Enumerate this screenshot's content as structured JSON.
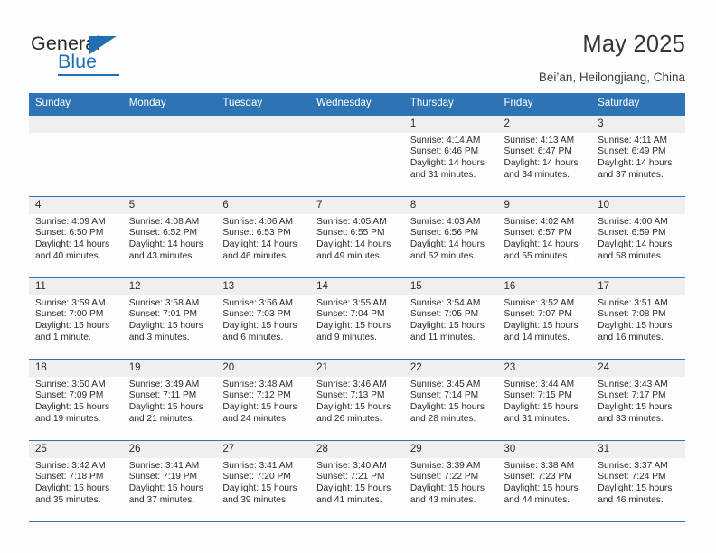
{
  "logo": {
    "word_one": "General",
    "word_two": "Blue",
    "triangle_icon": "blue-triangle-icon"
  },
  "header": {
    "title": "May 2025",
    "subtitle": "Bei’an, Heilongjiang, China"
  },
  "colors": {
    "header_blue": "#2e74b5",
    "daynum_gray": "#efefef",
    "page_bg": "#fdfdfd",
    "text": "#2b2b2b",
    "logo_blue": "#1f6fb5"
  },
  "weekday_headers": [
    "Sunday",
    "Monday",
    "Tuesday",
    "Wednesday",
    "Thursday",
    "Friday",
    "Saturday"
  ],
  "labels": {
    "sunrise": "Sunrise:",
    "sunset": "Sunset:",
    "daylight": "Daylight:"
  },
  "weeks": [
    [
      {
        "day": "",
        "empty": true
      },
      {
        "day": "",
        "empty": true
      },
      {
        "day": "",
        "empty": true
      },
      {
        "day": "",
        "empty": true
      },
      {
        "day": "1",
        "sunrise": "Sunrise: 4:14 AM",
        "sunset": "Sunset: 6:46 PM",
        "daylight_l1": "Daylight: 14 hours",
        "daylight_l2": "and 31 minutes."
      },
      {
        "day": "2",
        "sunrise": "Sunrise: 4:13 AM",
        "sunset": "Sunset: 6:47 PM",
        "daylight_l1": "Daylight: 14 hours",
        "daylight_l2": "and 34 minutes."
      },
      {
        "day": "3",
        "sunrise": "Sunrise: 4:11 AM",
        "sunset": "Sunset: 6:49 PM",
        "daylight_l1": "Daylight: 14 hours",
        "daylight_l2": "and 37 minutes."
      }
    ],
    [
      {
        "day": "4",
        "sunrise": "Sunrise: 4:09 AM",
        "sunset": "Sunset: 6:50 PM",
        "daylight_l1": "Daylight: 14 hours",
        "daylight_l2": "and 40 minutes."
      },
      {
        "day": "5",
        "sunrise": "Sunrise: 4:08 AM",
        "sunset": "Sunset: 6:52 PM",
        "daylight_l1": "Daylight: 14 hours",
        "daylight_l2": "and 43 minutes."
      },
      {
        "day": "6",
        "sunrise": "Sunrise: 4:06 AM",
        "sunset": "Sunset: 6:53 PM",
        "daylight_l1": "Daylight: 14 hours",
        "daylight_l2": "and 46 minutes."
      },
      {
        "day": "7",
        "sunrise": "Sunrise: 4:05 AM",
        "sunset": "Sunset: 6:55 PM",
        "daylight_l1": "Daylight: 14 hours",
        "daylight_l2": "and 49 minutes."
      },
      {
        "day": "8",
        "sunrise": "Sunrise: 4:03 AM",
        "sunset": "Sunset: 6:56 PM",
        "daylight_l1": "Daylight: 14 hours",
        "daylight_l2": "and 52 minutes."
      },
      {
        "day": "9",
        "sunrise": "Sunrise: 4:02 AM",
        "sunset": "Sunset: 6:57 PM",
        "daylight_l1": "Daylight: 14 hours",
        "daylight_l2": "and 55 minutes."
      },
      {
        "day": "10",
        "sunrise": "Sunrise: 4:00 AM",
        "sunset": "Sunset: 6:59 PM",
        "daylight_l1": "Daylight: 14 hours",
        "daylight_l2": "and 58 minutes."
      }
    ],
    [
      {
        "day": "11",
        "sunrise": "Sunrise: 3:59 AM",
        "sunset": "Sunset: 7:00 PM",
        "daylight_l1": "Daylight: 15 hours",
        "daylight_l2": "and 1 minute."
      },
      {
        "day": "12",
        "sunrise": "Sunrise: 3:58 AM",
        "sunset": "Sunset: 7:01 PM",
        "daylight_l1": "Daylight: 15 hours",
        "daylight_l2": "and 3 minutes."
      },
      {
        "day": "13",
        "sunrise": "Sunrise: 3:56 AM",
        "sunset": "Sunset: 7:03 PM",
        "daylight_l1": "Daylight: 15 hours",
        "daylight_l2": "and 6 minutes."
      },
      {
        "day": "14",
        "sunrise": "Sunrise: 3:55 AM",
        "sunset": "Sunset: 7:04 PM",
        "daylight_l1": "Daylight: 15 hours",
        "daylight_l2": "and 9 minutes."
      },
      {
        "day": "15",
        "sunrise": "Sunrise: 3:54 AM",
        "sunset": "Sunset: 7:05 PM",
        "daylight_l1": "Daylight: 15 hours",
        "daylight_l2": "and 11 minutes."
      },
      {
        "day": "16",
        "sunrise": "Sunrise: 3:52 AM",
        "sunset": "Sunset: 7:07 PM",
        "daylight_l1": "Daylight: 15 hours",
        "daylight_l2": "and 14 minutes."
      },
      {
        "day": "17",
        "sunrise": "Sunrise: 3:51 AM",
        "sunset": "Sunset: 7:08 PM",
        "daylight_l1": "Daylight: 15 hours",
        "daylight_l2": "and 16 minutes."
      }
    ],
    [
      {
        "day": "18",
        "sunrise": "Sunrise: 3:50 AM",
        "sunset": "Sunset: 7:09 PM",
        "daylight_l1": "Daylight: 15 hours",
        "daylight_l2": "and 19 minutes."
      },
      {
        "day": "19",
        "sunrise": "Sunrise: 3:49 AM",
        "sunset": "Sunset: 7:11 PM",
        "daylight_l1": "Daylight: 15 hours",
        "daylight_l2": "and 21 minutes."
      },
      {
        "day": "20",
        "sunrise": "Sunrise: 3:48 AM",
        "sunset": "Sunset: 7:12 PM",
        "daylight_l1": "Daylight: 15 hours",
        "daylight_l2": "and 24 minutes."
      },
      {
        "day": "21",
        "sunrise": "Sunrise: 3:46 AM",
        "sunset": "Sunset: 7:13 PM",
        "daylight_l1": "Daylight: 15 hours",
        "daylight_l2": "and 26 minutes."
      },
      {
        "day": "22",
        "sunrise": "Sunrise: 3:45 AM",
        "sunset": "Sunset: 7:14 PM",
        "daylight_l1": "Daylight: 15 hours",
        "daylight_l2": "and 28 minutes."
      },
      {
        "day": "23",
        "sunrise": "Sunrise: 3:44 AM",
        "sunset": "Sunset: 7:15 PM",
        "daylight_l1": "Daylight: 15 hours",
        "daylight_l2": "and 31 minutes."
      },
      {
        "day": "24",
        "sunrise": "Sunrise: 3:43 AM",
        "sunset": "Sunset: 7:17 PM",
        "daylight_l1": "Daylight: 15 hours",
        "daylight_l2": "and 33 minutes."
      }
    ],
    [
      {
        "day": "25",
        "sunrise": "Sunrise: 3:42 AM",
        "sunset": "Sunset: 7:18 PM",
        "daylight_l1": "Daylight: 15 hours",
        "daylight_l2": "and 35 minutes."
      },
      {
        "day": "26",
        "sunrise": "Sunrise: 3:41 AM",
        "sunset": "Sunset: 7:19 PM",
        "daylight_l1": "Daylight: 15 hours",
        "daylight_l2": "and 37 minutes."
      },
      {
        "day": "27",
        "sunrise": "Sunrise: 3:41 AM",
        "sunset": "Sunset: 7:20 PM",
        "daylight_l1": "Daylight: 15 hours",
        "daylight_l2": "and 39 minutes."
      },
      {
        "day": "28",
        "sunrise": "Sunrise: 3:40 AM",
        "sunset": "Sunset: 7:21 PM",
        "daylight_l1": "Daylight: 15 hours",
        "daylight_l2": "and 41 minutes."
      },
      {
        "day": "29",
        "sunrise": "Sunrise: 3:39 AM",
        "sunset": "Sunset: 7:22 PM",
        "daylight_l1": "Daylight: 15 hours",
        "daylight_l2": "and 43 minutes."
      },
      {
        "day": "30",
        "sunrise": "Sunrise: 3:38 AM",
        "sunset": "Sunset: 7:23 PM",
        "daylight_l1": "Daylight: 15 hours",
        "daylight_l2": "and 44 minutes."
      },
      {
        "day": "31",
        "sunrise": "Sunrise: 3:37 AM",
        "sunset": "Sunset: 7:24 PM",
        "daylight_l1": "Daylight: 15 hours",
        "daylight_l2": "and 46 minutes."
      }
    ]
  ]
}
